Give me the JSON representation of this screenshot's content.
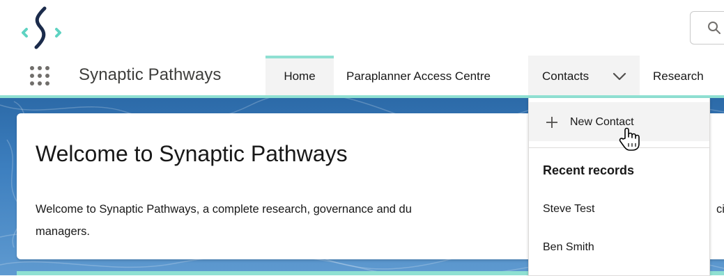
{
  "header": {
    "search_icon": "search-icon",
    "search_char": "Q"
  },
  "nav": {
    "app_launcher_icon": "app-launcher-grid-icon",
    "app_name": "Synaptic Pathways",
    "tabs": [
      {
        "label": "Home",
        "active": true
      },
      {
        "label": "Paraplanner Access Centre"
      },
      {
        "label": "Contacts",
        "has_dropdown": true
      },
      {
        "label": "Research"
      }
    ],
    "accent_color": "#8fe0d2"
  },
  "welcome": {
    "title": "Welcome to Synaptic Pathways",
    "body_line1_visible": "Welcome to Synaptic Pathways, a complete research, governance and du",
    "body_line1_right": "cia",
    "body_line2": "managers."
  },
  "dropdown": {
    "new_label": "New Contact",
    "recent_heading": "Recent records",
    "recent": [
      "Steve Test",
      "Ben Smith"
    ]
  },
  "colors": {
    "banner": "#3d7fbf",
    "tab_bg": "#f3f3f3",
    "logo_teal": "#5fd3c2",
    "logo_navy": "#1b2b4b"
  }
}
